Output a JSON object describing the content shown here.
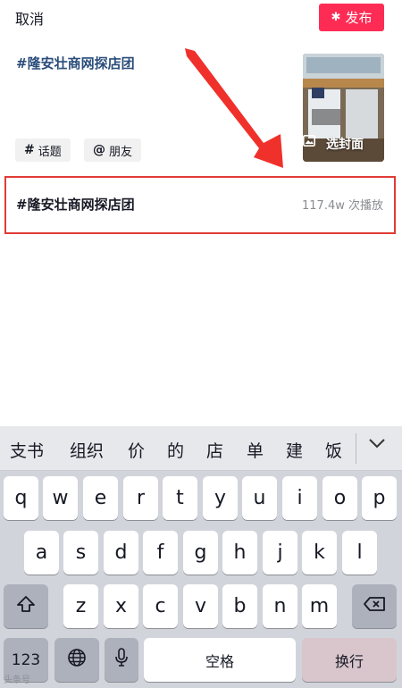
{
  "header": {
    "cancel_label": "取消",
    "publish_label": "发布"
  },
  "post": {
    "caption": "#隆安壮商网探店团",
    "cover_label": "选封面",
    "chips": [
      {
        "icon": "#",
        "label": "话题"
      },
      {
        "icon": "@",
        "label": "朋友"
      }
    ]
  },
  "suggestion": {
    "tag": "#隆安壮商网探店团",
    "plays": "117.4w 次播放"
  },
  "keyboard": {
    "candidates": [
      "支书",
      "组织",
      "价",
      "的",
      "店",
      "单",
      "建",
      "饭"
    ],
    "row1": [
      "q",
      "w",
      "e",
      "r",
      "t",
      "y",
      "u",
      "i",
      "o",
      "p"
    ],
    "row2": [
      "a",
      "s",
      "d",
      "f",
      "g",
      "h",
      "j",
      "k",
      "l"
    ],
    "row3": [
      "z",
      "x",
      "c",
      "v",
      "b",
      "n",
      "m"
    ],
    "num_label": "123",
    "space_label": "空格",
    "enter_label": "换行"
  },
  "watermark": "头条号",
  "colors": {
    "accent": "#fe2c55",
    "highlight_border": "#e13b36",
    "arrow": "#f0312b"
  }
}
